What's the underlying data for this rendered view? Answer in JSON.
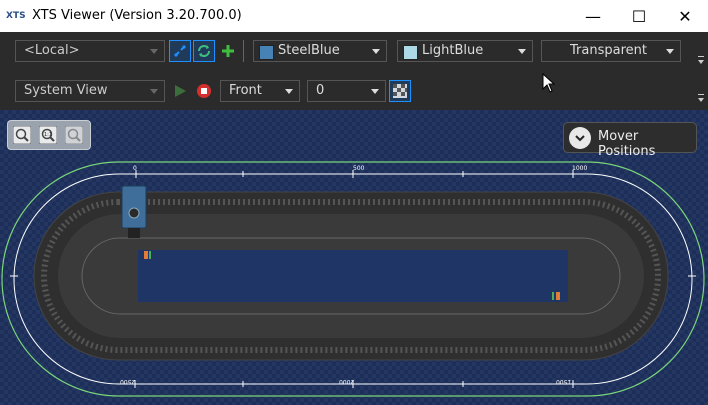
{
  "window": {
    "logo_text": "XTS",
    "title": "XTS Viewer (Version 3.20.700.0)",
    "minimize_glyph": "—",
    "maximize_glyph": "☐",
    "close_glyph": "✕"
  },
  "toolbar": {
    "target_combo": {
      "value": "<Local>"
    },
    "color1_combo": {
      "value": "SteelBlue",
      "swatch_color": "#4682b4"
    },
    "color2_combo": {
      "value": "LightBlue",
      "swatch_color": "#add8e6"
    },
    "color3_combo": {
      "value": "Transparent"
    },
    "view_combo": {
      "value": "System View"
    },
    "side_combo": {
      "value": "Front"
    },
    "index_combo": {
      "value": "0"
    }
  },
  "viewer": {
    "mover_positions_label": "Mover Positions",
    "scale_top": [
      "0",
      "500",
      "1000"
    ],
    "scale_bottom": [
      "2500",
      "2000",
      "1500"
    ]
  },
  "colors": {
    "accent": "#1e90ff",
    "play_disabled": "#3c6e3c",
    "stop": "#d32f2f",
    "add": "#3fbf3f",
    "background": "#1c2f5a"
  }
}
